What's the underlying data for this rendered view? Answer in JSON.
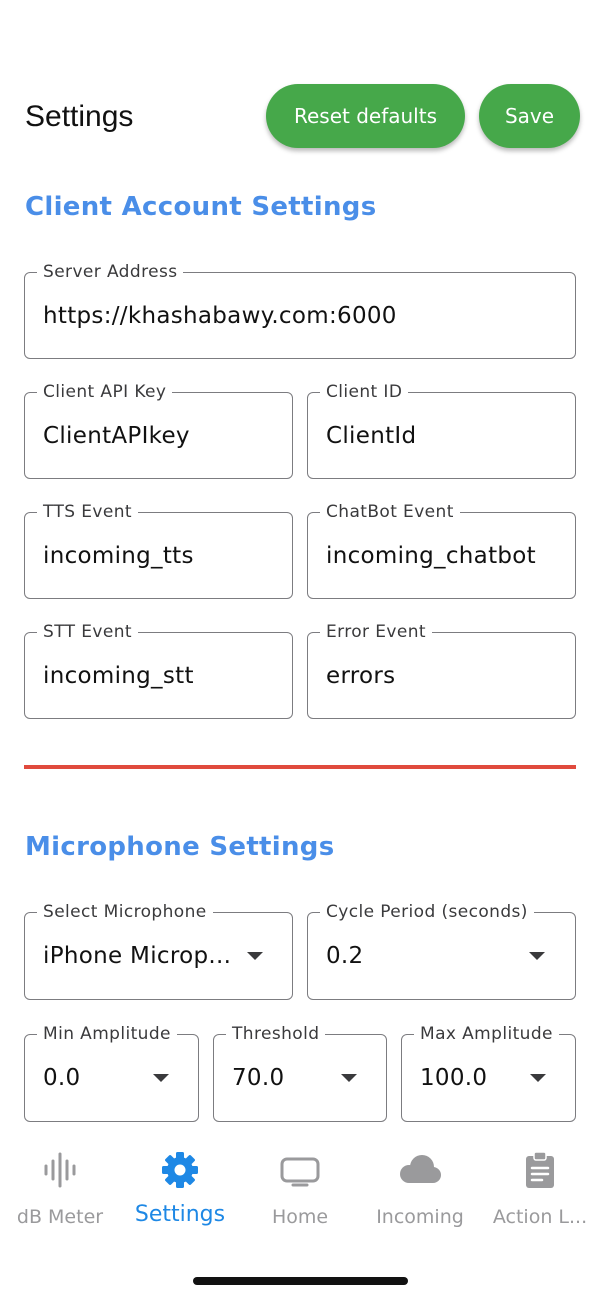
{
  "header": {
    "title": "Settings",
    "reset_label": "Reset defaults",
    "save_label": "Save"
  },
  "client_section": {
    "title": "Client Account Settings",
    "server_address": {
      "label": "Server Address",
      "value": "https://khashabawy.com:6000"
    },
    "api_key": {
      "label": "Client API Key",
      "value": "ClientAPIkey"
    },
    "client_id": {
      "label": "Client ID",
      "value": "ClientId"
    },
    "tts_event": {
      "label": "TTS Event",
      "value": "incoming_tts"
    },
    "chatbot_event": {
      "label": "ChatBot Event",
      "value": "incoming_chatbot"
    },
    "stt_event": {
      "label": "STT Event",
      "value": "incoming_stt"
    },
    "error_event": {
      "label": "Error Event",
      "value": "errors"
    }
  },
  "mic_section": {
    "title": "Microphone Settings",
    "microphone": {
      "label": "Select Microphone",
      "value": "iPhone Microp..."
    },
    "cycle_period": {
      "label": "Cycle Period (seconds)",
      "value": "0.2"
    },
    "min_amplitude": {
      "label": "Min Amplitude",
      "value": "0.0"
    },
    "threshold": {
      "label": "Threshold",
      "value": "70.0"
    },
    "max_amplitude": {
      "label": "Max Amplitude",
      "value": "100.0"
    }
  },
  "nav": {
    "active": "Settings",
    "items": [
      {
        "label": "dB Meter",
        "icon": "waveform-icon"
      },
      {
        "label": "Settings",
        "icon": "gear-icon"
      },
      {
        "label": "Home",
        "icon": "tv-icon"
      },
      {
        "label": "Incoming",
        "icon": "cloud-icon"
      },
      {
        "label": "Action L...",
        "icon": "clipboard-icon"
      }
    ]
  },
  "colors": {
    "accent_button": "#46a84a",
    "section_title": "#4a8ee8",
    "divider": "#e04a3d",
    "nav_active": "#1e88e5",
    "nav_inactive": "#9a9a9c"
  }
}
